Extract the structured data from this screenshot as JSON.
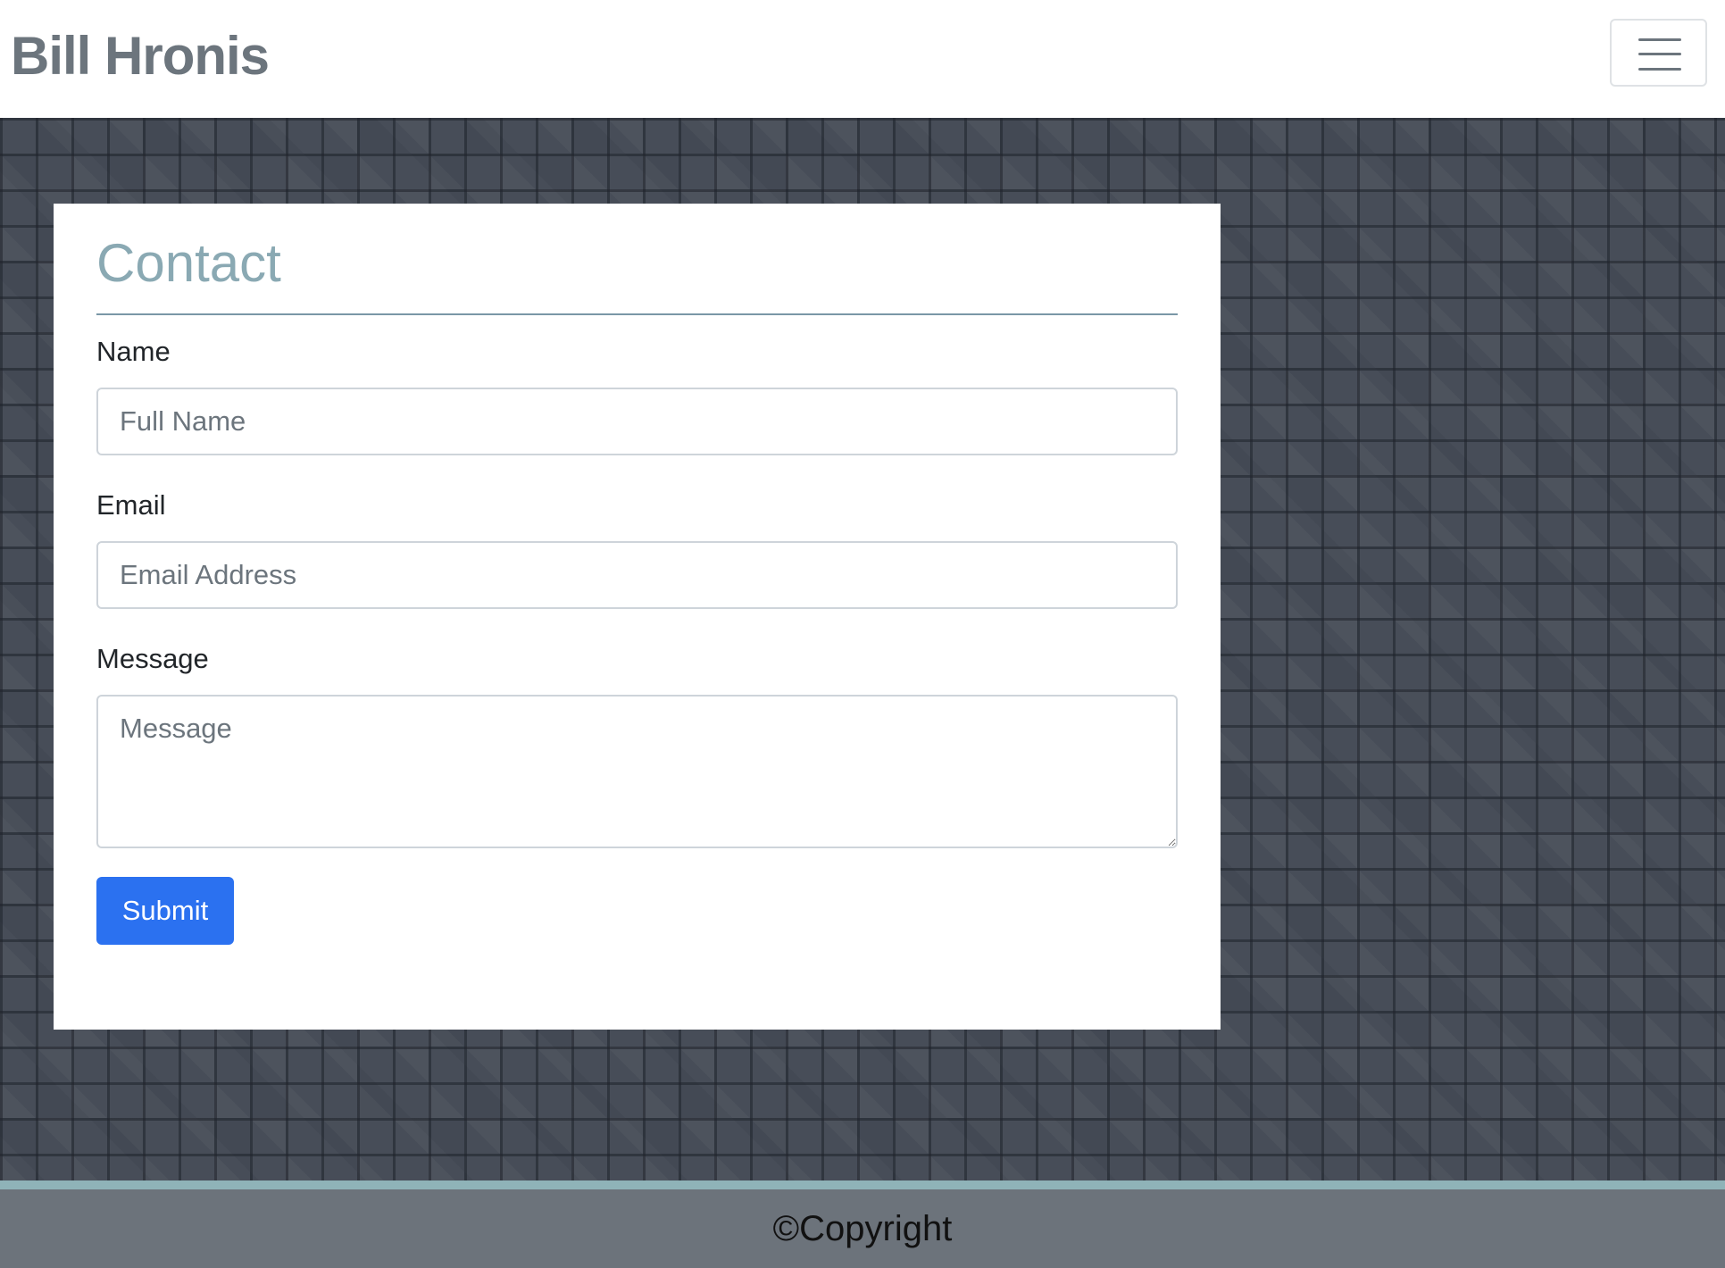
{
  "header": {
    "brand": "Bill Hronis",
    "menu_icon": "hamburger-menu-icon"
  },
  "contact": {
    "title": "Contact",
    "name": {
      "label": "Name",
      "placeholder": "Full Name",
      "value": ""
    },
    "email": {
      "label": "Email",
      "placeholder": "Email Address",
      "value": ""
    },
    "message": {
      "label": "Message",
      "placeholder": "Message",
      "value": ""
    },
    "submit_label": "Submit"
  },
  "footer": {
    "copyright": "©Copyright"
  },
  "colors": {
    "brand_text": "#6c757d",
    "title": "#8aa9b3",
    "primary_button": "#2b71f0",
    "background": "#474d58",
    "footer": "#6c737b",
    "footer_accent": "#8fb3b8"
  }
}
